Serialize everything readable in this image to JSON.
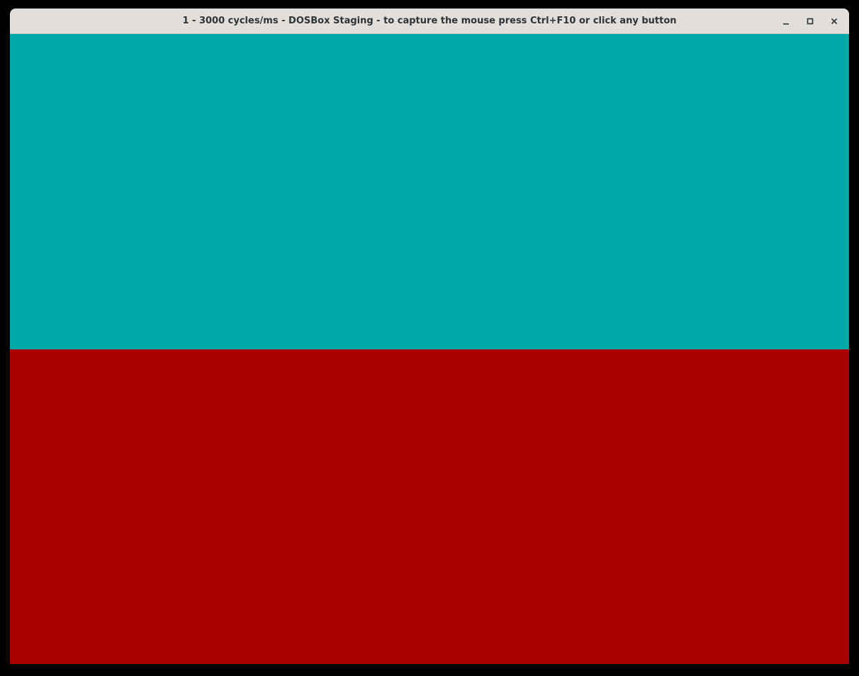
{
  "window": {
    "title": "1 - 3000 cycles/ms - DOSBox Staging - to capture the mouse press Ctrl+F10 or click any button",
    "controls": {
      "minimize_icon": "minimize-icon",
      "maximize_icon": "maximize-icon",
      "close_icon": "close-icon"
    }
  },
  "screen": {
    "top_color": "#00aaaa",
    "bottom_color": "#aa0000"
  }
}
